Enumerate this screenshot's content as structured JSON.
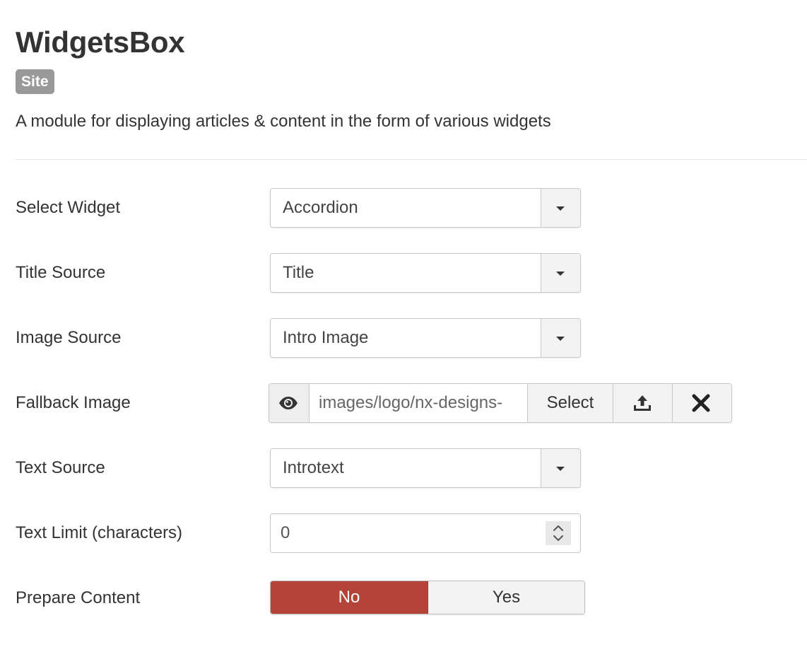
{
  "header": {
    "title": "WidgetsBox",
    "badge": "Site",
    "description": "A module for displaying articles & content in the form of various widgets"
  },
  "fields": {
    "select_widget": {
      "label": "Select Widget",
      "value": "Accordion"
    },
    "title_source": {
      "label": "Title Source",
      "value": "Title"
    },
    "image_source": {
      "label": "Image Source",
      "value": "Intro Image"
    },
    "fallback_image": {
      "label": "Fallback Image",
      "value": "images/logo/nx-designs-",
      "select_label": "Select",
      "preview_icon": "eye-icon",
      "upload_icon": "upload-icon",
      "clear_icon": "close-icon"
    },
    "text_source": {
      "label": "Text Source",
      "value": "Introtext"
    },
    "text_limit": {
      "label": "Text Limit (characters)",
      "value": "0"
    },
    "prepare_content": {
      "label": "Prepare Content",
      "options": {
        "no": "No",
        "yes": "Yes"
      },
      "selected": "No"
    }
  },
  "colors": {
    "badge": "#999999",
    "toggle_active": "#b4433a"
  }
}
